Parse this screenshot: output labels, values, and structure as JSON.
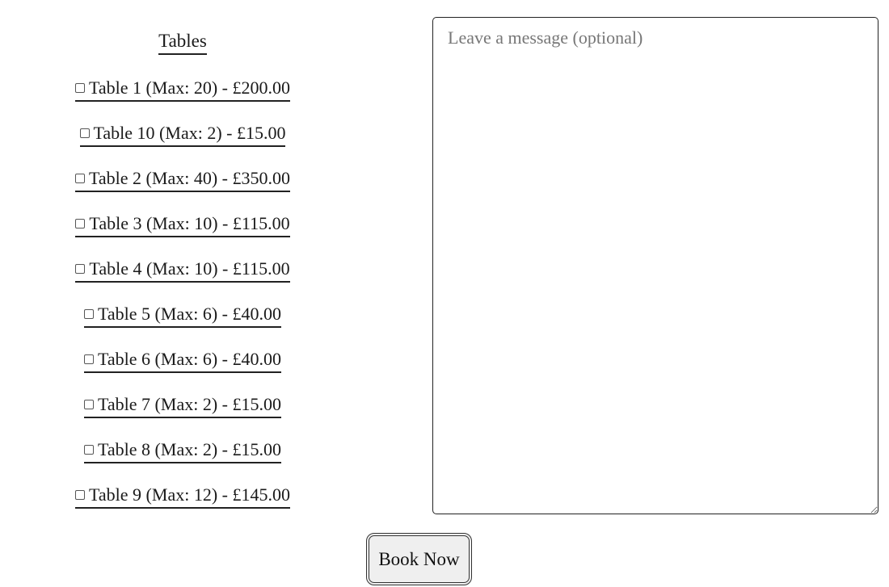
{
  "tables_heading": "Tables",
  "tables": [
    {
      "label": "Table 1 (Max: 20) - £200.00",
      "checked": false
    },
    {
      "label": "Table 10 (Max: 2) - £15.00",
      "checked": false
    },
    {
      "label": "Table 2 (Max: 40) - £350.00",
      "checked": false
    },
    {
      "label": "Table 3 (Max: 10) - £115.00",
      "checked": false
    },
    {
      "label": "Table 4 (Max: 10) - £115.00",
      "checked": false
    },
    {
      "label": "Table 5 (Max: 6) - £40.00",
      "checked": false
    },
    {
      "label": "Table 6 (Max: 6) - £40.00",
      "checked": false
    },
    {
      "label": "Table 7 (Max: 2) - £15.00",
      "checked": false
    },
    {
      "label": "Table 8 (Max: 2) - £15.00",
      "checked": false
    },
    {
      "label": "Table 9 (Max: 12) - £145.00",
      "checked": false
    }
  ],
  "message": {
    "placeholder": "Leave a message (optional)",
    "value": ""
  },
  "book_button": "Book Now"
}
